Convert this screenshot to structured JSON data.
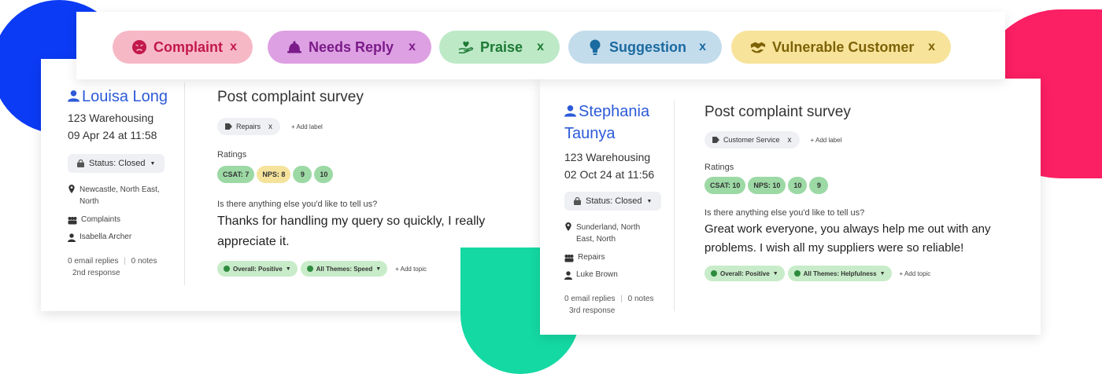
{
  "tags": [
    {
      "label": "Complaint",
      "remove": "x",
      "icon": "angry-face-icon",
      "color": "#c2184b"
    },
    {
      "label": "Needs Reply",
      "remove": "x",
      "icon": "bell-icon",
      "color": "#7b1b8a"
    },
    {
      "label": "Praise",
      "remove": "x",
      "icon": "hand-heart-icon",
      "color": "#1d7a34"
    },
    {
      "label": "Suggestion",
      "remove": "x",
      "icon": "lightbulb-icon",
      "color": "#1b6aa0"
    },
    {
      "label": "Vulnerable Customer",
      "remove": "x",
      "icon": "handshake-icon",
      "color": "#7d6206"
    }
  ],
  "cards": [
    {
      "customer_name": "Louisa Long",
      "company": "123 Warehousing",
      "date": "09 Apr 24 at 11:58",
      "status": "Status: Closed",
      "location": "Newcastle, North East, North",
      "category": "Complaints",
      "agent": "Isabella Archer",
      "email_replies": "0 email replies",
      "notes": "0 notes",
      "response": "2nd response",
      "survey_title": "Post complaint survey",
      "label": "Repairs",
      "label_remove": "x",
      "add_label": "+ Add label",
      "ratings_label": "Ratings",
      "ratings": [
        "CSAT: 7",
        "NPS: 8",
        "9",
        "10"
      ],
      "question": "Is there anything else you'd like to tell us?",
      "answer_line1": "Thanks for handling my query so quickly, I really",
      "answer_line2": "appreciate it.",
      "topics": [
        "Overall: Positive",
        "All Themes: Speed"
      ],
      "add_topic": "+ Add topic"
    },
    {
      "customer_name_line1": "Stephania",
      "customer_name_line2": "Taunya",
      "company": "123 Warehousing",
      "date": "02 Oct 24 at 11:56",
      "status": "Status: Closed",
      "location": "Sunderland, North East, North",
      "category": "Repairs",
      "agent": "Luke Brown",
      "email_replies": "0 email replies",
      "notes": "0 notes",
      "response": "3rd response",
      "survey_title": "Post complaint survey",
      "label": "Customer Service",
      "label_remove": "x",
      "add_label": "+ Add label",
      "ratings_label": "Ratings",
      "ratings": [
        "CSAT: 10",
        "NPS: 10",
        "10",
        "9"
      ],
      "question": "Is there anything else you'd like to tell us?",
      "answer_line1": "Great work everyone, you always help me out with any",
      "answer_line2": "problems. I wish all my suppliers were so reliable!",
      "topics": [
        "Overall: Positive",
        "All Themes: Helpfulness"
      ],
      "add_topic": "+ Add topic"
    }
  ]
}
